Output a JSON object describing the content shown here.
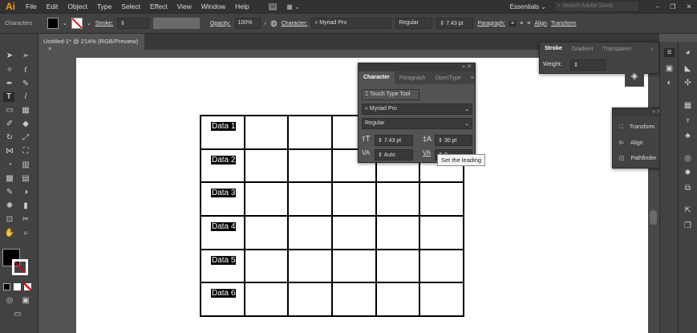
{
  "app": {
    "logo": "Ai"
  },
  "menu": [
    "File",
    "Edit",
    "Object",
    "Type",
    "Select",
    "Effect",
    "View",
    "Window",
    "Help"
  ],
  "workspace": {
    "name": "Essentials",
    "search_placeholder": "Search Adobe Stock"
  },
  "control": {
    "selection": "Characters",
    "stroke_label": "Stroke:",
    "opacity_label": "Opacity:",
    "opacity": "100%",
    "character_label": "Character:",
    "font": "Myriad Pro",
    "style": "Regular",
    "size": "7.43 pt",
    "paragraph_label": "Paragraph:",
    "align": "Align",
    "transform": "Transform"
  },
  "document": {
    "tab": "Untitled-1* @ 214% (RGB/Preview)",
    "close": "×"
  },
  "table": {
    "rows": [
      "Data 1",
      "Data 2",
      "Data 3",
      "Data 4",
      "Data 5",
      "Data 6"
    ]
  },
  "character_panel": {
    "tabs": [
      "Character",
      "Paragraph",
      "OpenType"
    ],
    "touch_type": "Touch Type Tool",
    "font": "Myriad Pro",
    "style": "Regular",
    "size": "7.43 pt",
    "leading": "30 pt",
    "kerning": "Auto",
    "tracking": "0"
  },
  "tooltip": "Set the leading",
  "stroke_panel": {
    "tabs": [
      "Stroke",
      "Gradient",
      "Transparen"
    ],
    "weight_label": "Weight:"
  },
  "mini_panel": {
    "items": [
      "Transform",
      "Align",
      "Pathfinder"
    ]
  },
  "colors": {
    "accent": "#ff9a00",
    "ui_dark": "#323232",
    "ui_mid": "#424242",
    "canvas": "#535353"
  }
}
